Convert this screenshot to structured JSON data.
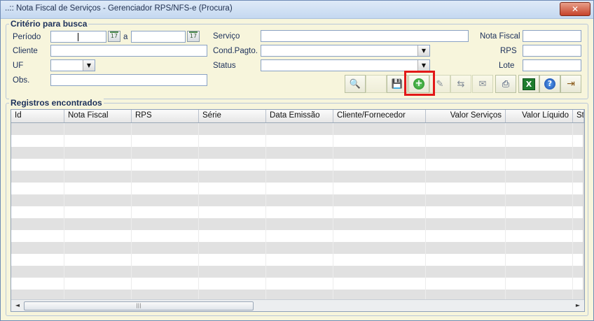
{
  "window": {
    "title": "..:: Nota Fiscal de Serviços - Gerenciador RPS/NFS-e (Procura)",
    "close_glyph": "✕"
  },
  "criteria": {
    "legend": "Critério para busca",
    "periodo_label": "Período",
    "periodo_sep": "a",
    "cliente_label": "Cliente",
    "uf_label": "UF",
    "obs_label": "Obs.",
    "servico_label": "Serviço",
    "condpagto_label": "Cond.Pagto.",
    "status_label": "Status",
    "notafiscal_label": "Nota Fiscal",
    "rps_label": "RPS",
    "lote_label": "Lote",
    "calendar_day": "17"
  },
  "toolbar": {
    "buttons": [
      {
        "name": "search-button",
        "icon": "search-icon",
        "glyph": "🔍",
        "enabled": true
      },
      {
        "name": "blank-button",
        "icon": "blank-icon",
        "glyph": "",
        "enabled": false
      },
      {
        "name": "export-button",
        "icon": "save-icon",
        "glyph": "💾",
        "enabled": true
      },
      {
        "name": "add-button",
        "icon": "add-circle-icon",
        "glyph": "+",
        "enabled": true,
        "highlighted": true
      },
      {
        "name": "edit-button",
        "icon": "pencil-icon",
        "glyph": "✎",
        "enabled": false
      },
      {
        "name": "send-button",
        "icon": "send-icon",
        "glyph": "⇆",
        "enabled": false
      },
      {
        "name": "transmit-button",
        "icon": "transmit-icon",
        "glyph": "✉",
        "enabled": false
      },
      {
        "name": "print-button",
        "icon": "printer-icon",
        "glyph": "⎙",
        "enabled": true
      },
      {
        "name": "excel-button",
        "icon": "excel-icon",
        "glyph": "X",
        "enabled": true
      },
      {
        "name": "help-button",
        "icon": "help-icon",
        "glyph": "?",
        "enabled": true
      },
      {
        "name": "exit-button",
        "icon": "exit-door-icon",
        "glyph": "⇥",
        "enabled": true
      }
    ]
  },
  "results": {
    "legend": "Registros encontrados",
    "columns": [
      "Id",
      "Nota Fiscal",
      "RPS",
      "Série",
      "Data Emissão",
      "Cliente/Fornecedor",
      "Valor Serviços",
      "Valor Líquido",
      "St"
    ],
    "scroll_left": "◄",
    "scroll_right": "►",
    "thumb_grip": "|||"
  },
  "colors": {
    "highlight": "#e21818",
    "grid_stripe": "#e1e1e1",
    "window_bg": "#f7f5dc"
  }
}
